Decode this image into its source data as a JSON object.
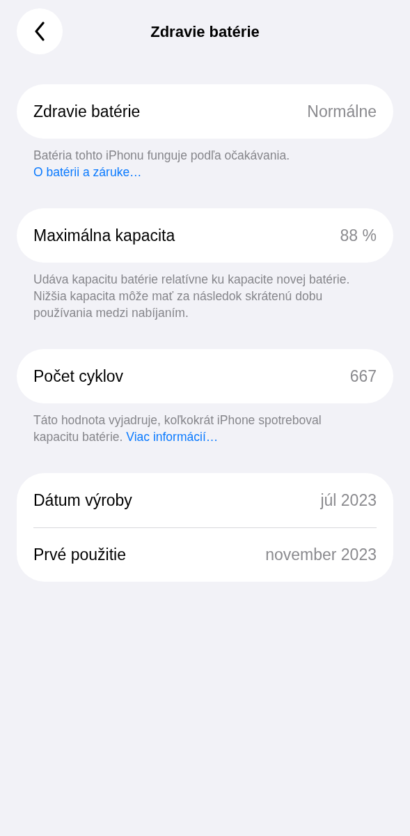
{
  "nav": {
    "title": "Zdravie batérie"
  },
  "sections": [
    {
      "rows": [
        {
          "label": "Zdravie batérie",
          "value": "Normálne"
        }
      ],
      "footer": {
        "text": "Batéria tohto iPhonu funguje podľa očakávania.",
        "link": "O batérii a záruke…"
      }
    },
    {
      "rows": [
        {
          "label": "Maximálna kapacita",
          "value": "88 %"
        }
      ],
      "footer": {
        "text": "Udáva kapacitu batérie relatívne ku kapacite novej batérie. Nižšia kapacita môže mať za následok skrátenú dobu používania medzi nabíjaním."
      }
    },
    {
      "rows": [
        {
          "label": "Počet cyklov",
          "value": "667"
        }
      ],
      "footer": {
        "text": "Táto hodnota vyjadruje, koľkokrát iPhone spotreboval kapacitu batérie.",
        "link": "Viac informácií…"
      }
    },
    {
      "rows": [
        {
          "label": "Dátum výroby",
          "value": "júl 2023"
        },
        {
          "label": "Prvé použitie",
          "value": "november 2023"
        }
      ]
    }
  ]
}
